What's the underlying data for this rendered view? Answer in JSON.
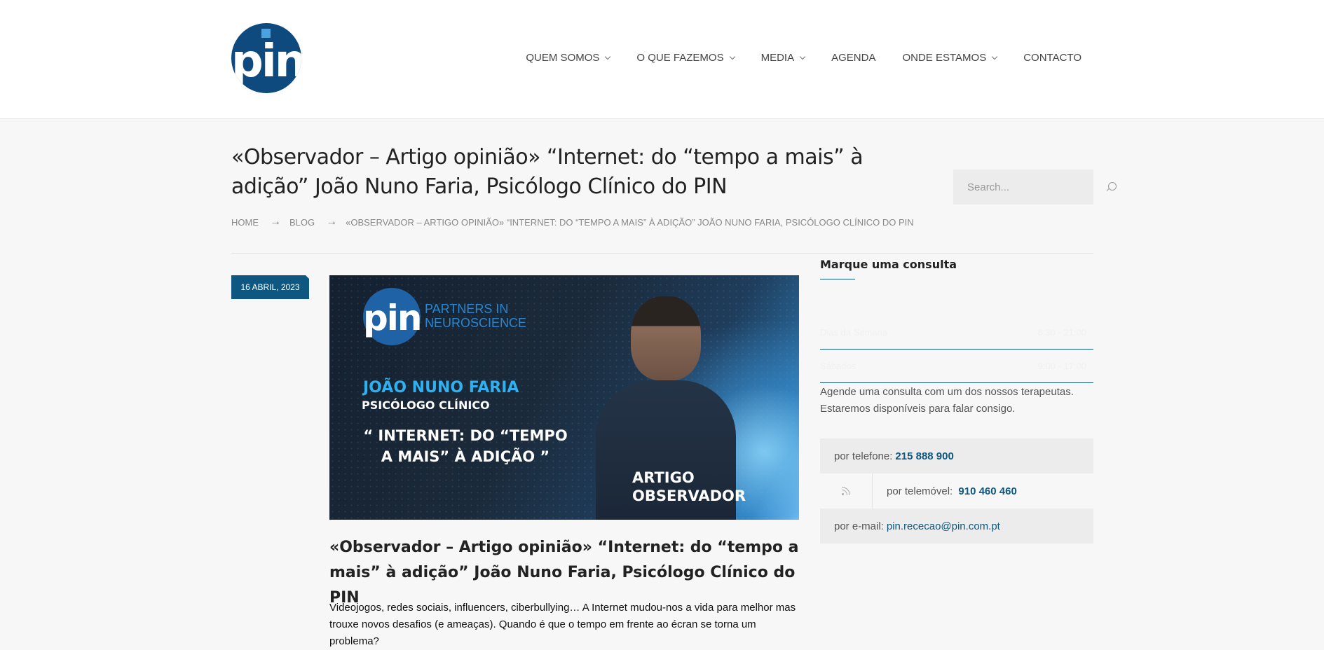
{
  "brand": {
    "logo_text": "pin",
    "logo_color": "#0e4a7d",
    "accent": "#0d5781"
  },
  "nav": {
    "items": [
      {
        "label": "QUEM SOMOS",
        "dropdown": true
      },
      {
        "label": "O QUE FAZEMOS",
        "dropdown": true
      },
      {
        "label": "MEDIA",
        "dropdown": true
      },
      {
        "label": "AGENDA",
        "dropdown": false
      },
      {
        "label": "ONDE ESTAMOS",
        "dropdown": true
      },
      {
        "label": "CONTACTO",
        "dropdown": false
      }
    ]
  },
  "page": {
    "title": "«Observador – Artigo opinião» “Internet: do “tempo a mais” à adição” João Nuno Faria, Psicólogo Clínico do PIN"
  },
  "search": {
    "placeholder": "Search..."
  },
  "breadcrumb": {
    "items": [
      "HOME",
      "BLOG",
      "«OBSERVADOR – ARTIGO OPINIÃO» “INTERNET: DO “TEMPO A MAIS” À ADIÇÃO” JOÃO NUNO FARIA, PSICÓLOGO CLÍNICO DO PIN"
    ]
  },
  "post": {
    "date": "16 ABRIL, 2023",
    "image": {
      "logo_text": "pin",
      "brand_line1": "PARTNERS IN",
      "brand_line2": "NEUROSCIENCE",
      "name": "JOÃO NUNO FARIA",
      "role": "PSICÓLOGO CLÍNICO",
      "quote_line1": "“ INTERNET: DO “TEMPO",
      "quote_line2": "A MAIS” À ADIÇÃO ”",
      "tag_line1": "ARTIGO",
      "tag_line2": "OBSERVADOR"
    },
    "title": "«Observador – Artigo opinião» “Internet: do “tempo a mais” à adição” João Nuno Faria, Psicólogo Clínico do PIN",
    "excerpt": "Videojogos, redes sociais, influencers, ciberbullying… A Internet mudou-nos a vida para melhor mas trouxe novos desafios (e ameaças). Quando é que o tempo em frente ao écran se torna um problema?"
  },
  "sidebar": {
    "widget_title": "Marque uma consulta",
    "hours": [
      {
        "day": "Dias da Semana",
        "time": "8:30 - 21:00"
      },
      {
        "day": "Sábados",
        "time": "9:00 - 17:00"
      }
    ],
    "consult_text": "Agende uma consulta com um dos nossos terapeutas. Estaremos disponíveis para falar consigo.",
    "phone_label": "por telefone:",
    "phone_value": "215 888 900",
    "mobile_label": "por telemóvel:",
    "mobile_value": "910 460 460",
    "email_label": "por e-mail:",
    "email_value": "pin.rececao@pin.com.pt"
  }
}
